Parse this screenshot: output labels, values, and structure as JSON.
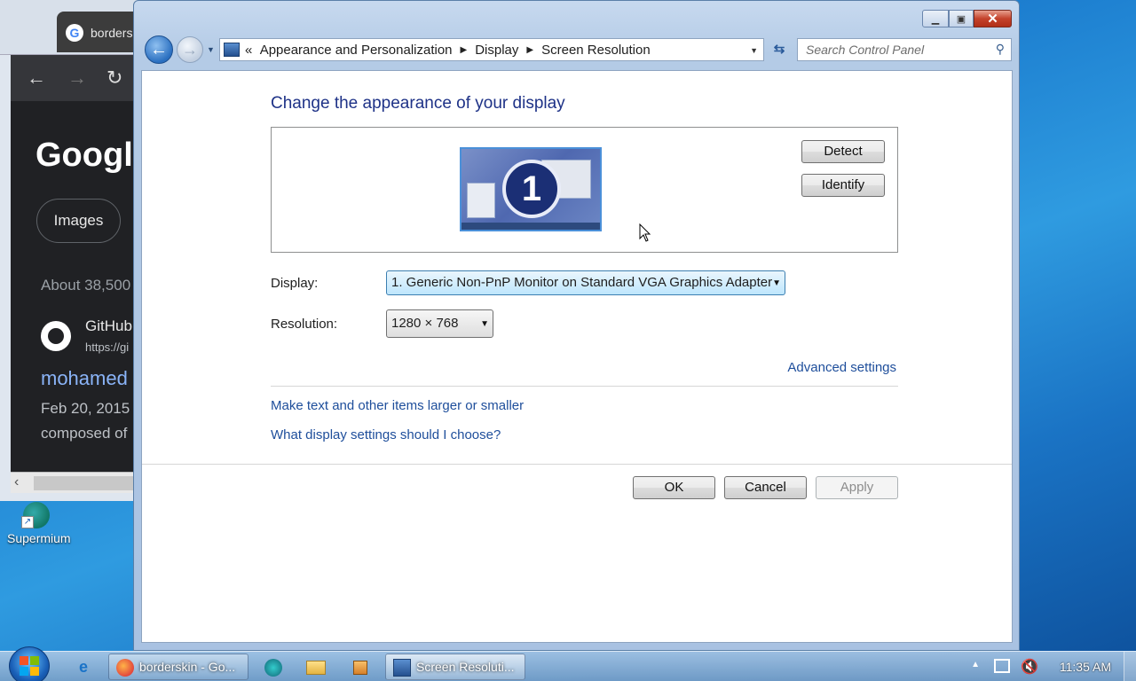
{
  "chrome": {
    "tab_title": "borders",
    "google_logo": "Google",
    "images_pill": "Images",
    "about": "About 38,500",
    "result_site": "GitHub",
    "result_url": "https://gi",
    "result_title": "mohamed",
    "result_date": "Feb 20, 2015",
    "result_desc": "composed of"
  },
  "desktop": {
    "icon_label": "Supermium"
  },
  "window": {
    "breadcrumb": [
      "Appearance and Personalization",
      "Display",
      "Screen Resolution"
    ],
    "breadcrumb_prefix": "«",
    "search_placeholder": "Search Control Panel",
    "heading": "Change the appearance of your display",
    "monitor_number": "1",
    "detect_label": "Detect",
    "identify_label": "Identify",
    "display_label": "Display:",
    "display_value": "1. Generic Non-PnP Monitor on Standard VGA Graphics Adapter",
    "resolution_label": "Resolution:",
    "resolution_value": "1280 × 768",
    "advanced_link": "Advanced settings",
    "text_size_link": "Make text and other items larger or smaller",
    "help_link": "What display settings should I choose?",
    "ok_label": "OK",
    "cancel_label": "Cancel",
    "apply_label": "Apply"
  },
  "taskbar": {
    "items": [
      {
        "label": "borderskin - Go...",
        "icon": "firefox-icon"
      },
      {
        "label": "Screen Resoluti...",
        "icon": "control-panel-icon"
      }
    ],
    "clock": "11:35 AM"
  },
  "colors": {
    "heading": "#1e3287",
    "link": "#1e4e9b",
    "desktop": "#1d7fd0"
  }
}
